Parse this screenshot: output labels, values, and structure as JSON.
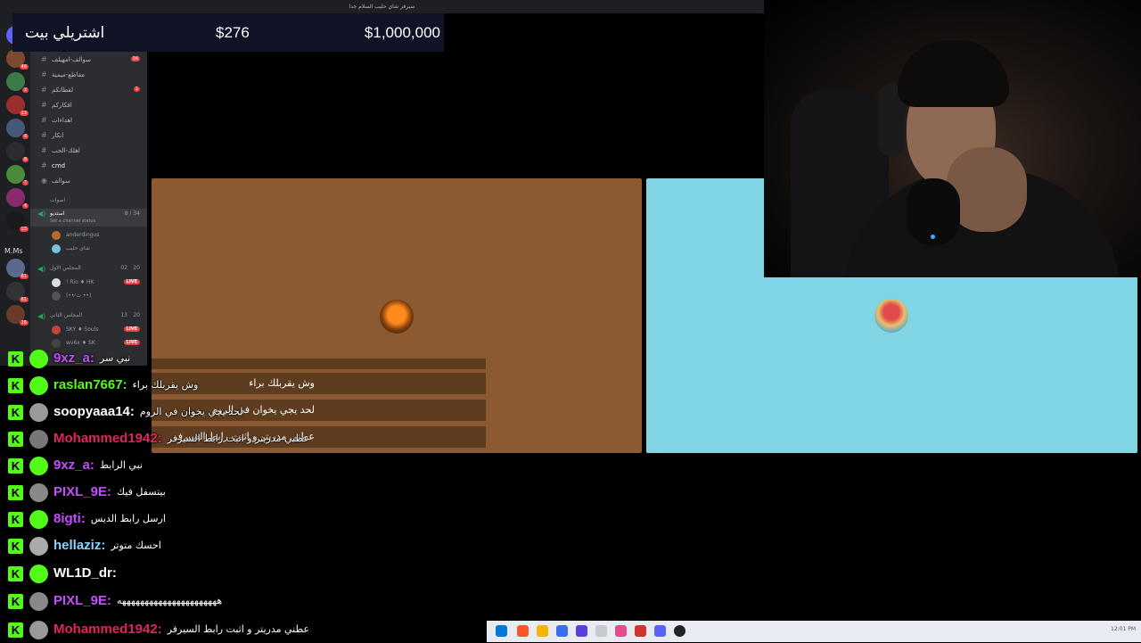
{
  "window": {
    "title": "سيرفر شاي حليب السلام جدا"
  },
  "score": {
    "name": "اشتريلي بيت",
    "current": "$276",
    "max": "$1,000,000"
  },
  "servers": {
    "mms_label": "M.Ms",
    "badges": [
      "46",
      "48",
      "2",
      "13",
      "4",
      "8",
      "7",
      "4",
      "13",
      "61",
      "61",
      "16"
    ]
  },
  "channels": [
    {
      "name": "سوالف-امهيلف",
      "badge": "34"
    },
    {
      "name": "مقاطع-ميمية",
      "badge": ""
    },
    {
      "name": "لقطاتكم",
      "badge": "1"
    },
    {
      "name": "افكاركم",
      "badge": ""
    },
    {
      "name": "اهداءات",
      "badge": ""
    },
    {
      "name": "انكار",
      "badge": ""
    },
    {
      "name": "اهلك-الحب",
      "badge": ""
    },
    {
      "name": "cmd",
      "badge": ""
    },
    {
      "name": "سوالف",
      "badge": ""
    }
  ],
  "voice": {
    "category": "اصوات",
    "channel_main": {
      "name": "استديو",
      "count": "8 / 34",
      "status": "Set a channel status"
    },
    "main_members": [
      "anderdingus",
      "شاي حليب"
    ],
    "channel_1": {
      "name": "المجلس الاول",
      "count_a": "02",
      "count_b": "20"
    },
    "ch1_members": [
      {
        "name": "! Rio ♦ HK",
        "live": "LIVE"
      },
      {
        "name": "(•• ت̷ ••)",
        "live": ""
      }
    ],
    "channel_2": {
      "name": "المجلس الثاني",
      "count_a": "13",
      "count_b": "20"
    },
    "ch2_members": [
      {
        "name": "SKY ♦ Souls",
        "live": "LIVE"
      },
      {
        "name": "wv6x ♦ SK",
        "live": "LIVE"
      }
    ]
  },
  "game": {
    "messages": [
      "وش يقربلك براء",
      "لحد يجي يخوان في الروم",
      "عطني مدريتر و اثبت رابط السيرفر"
    ]
  },
  "chat": [
    {
      "user": "9xz_a:",
      "text": "نبي سر",
      "color": "#c44dff"
    },
    {
      "user": "raslan7667:",
      "text": "وش يقربلك براء",
      "color": "#53fc18"
    },
    {
      "user": "soopyaaa14:",
      "text": "لحد يجي يخوان في الروم",
      "color": "#ffffff"
    },
    {
      "user": "Mohammed1942:",
      "text": "عطني مدريتر و اثبت رابط السيرفر",
      "color": "#e0245e"
    },
    {
      "user": "9xz_a:",
      "text": "نبي الرابط",
      "color": "#c44dff"
    },
    {
      "user": "PIXL_9E:",
      "text": "بيتسفل فيك",
      "color": "#c44dff"
    },
    {
      "user": "8igti:",
      "text": "ارسل رابط الديس",
      "color": "#c44dff"
    },
    {
      "user": "hellaziz:",
      "text": "احسك متوتر",
      "color": "#8fd1ff"
    },
    {
      "user": "WL1D_dr:",
      "text": "",
      "color": "#ffffff"
    },
    {
      "user": "PIXL_9E:",
      "text": "ههههههههههههههههههههههه",
      "color": "#c44dff"
    },
    {
      "user": "Mohammed1942:",
      "text": "عطني مدريتر و اثبت رابط السيرفر",
      "color": "#e0245e"
    }
  ],
  "kick_logo": "K",
  "taskbar": {
    "tray": "12:01 PM"
  },
  "colors": {
    "kick_green": "#53fc18",
    "brown_panel": "#8b5a32",
    "blue_panel": "#80d5e4",
    "score_bg": "#101226"
  }
}
